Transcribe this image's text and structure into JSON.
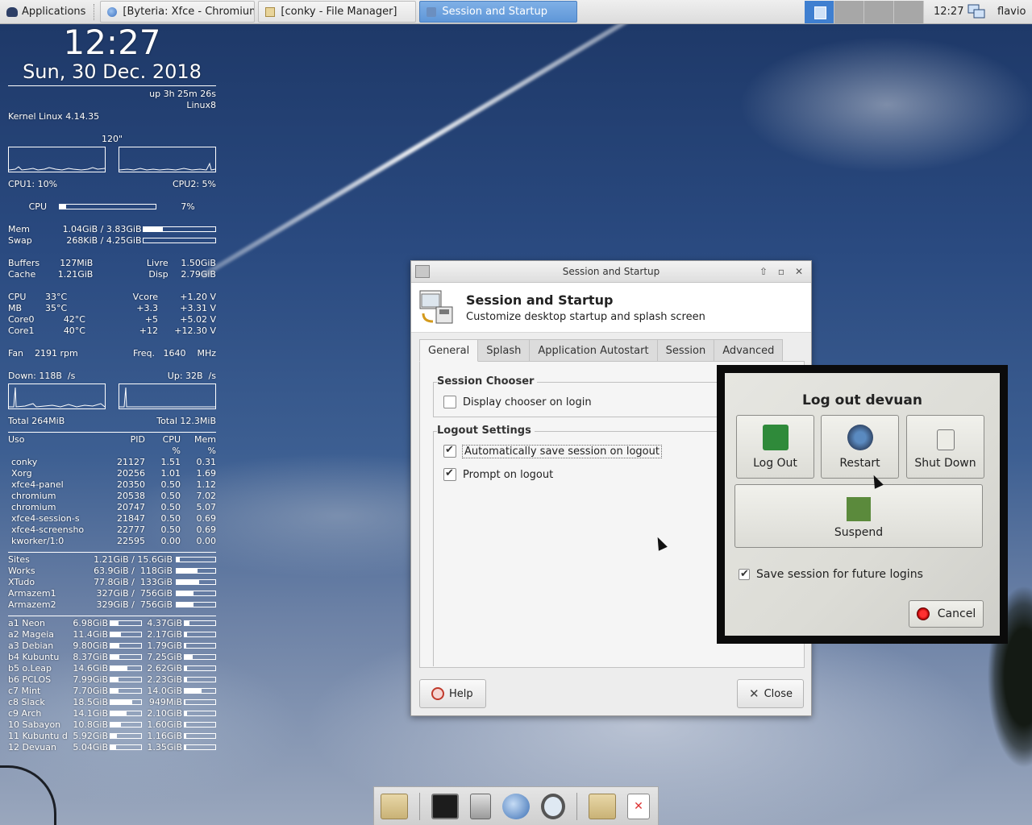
{
  "top_panel": {
    "applications_label": "Applications",
    "tasks": [
      {
        "label": "[Byteria: Xfce - Chromium]",
        "icon": "chromium-icon"
      },
      {
        "label": "[conky - File Manager]",
        "icon": "folder-icon"
      },
      {
        "label": "Session and Startup",
        "icon": "settings-icon"
      }
    ],
    "workspaces": 4,
    "active_workspace": 1,
    "clock": "12:27",
    "user": "flavio",
    "colors": {
      "active_task": "#5f97d8",
      "active_workspace": "#3f7fd0"
    }
  },
  "conky": {
    "time": "12:27",
    "date": "Sun, 30 Dec. 2018",
    "uptime": "up 3h 25m 26s",
    "host": "Linux8",
    "kernel": "Kernel Linux 4.14.35",
    "interval": "120\"",
    "cpu1": "CPU1: 10%",
    "cpu2": "CPU2: 5%",
    "cpu_label": "CPU",
    "cpu_pct_text": "7%",
    "cpu_pct": 0.07,
    "mem_label": "Mem",
    "mem_value": "1.04GiB / 3.83GiB",
    "mem_pct": 0.27,
    "swap_label": "Swap",
    "swap_value": "268KiB / 4.25GiB",
    "swap_pct": 0.0,
    "buffers_label": "Buffers",
    "buffers_value": "127MiB",
    "livre_label": "Livre",
    "livre_value": "1.50GiB",
    "cache_label": "Cache",
    "cache_value": "1.21GiB",
    "disp_label": "Disp",
    "disp_value": "2.79GiB",
    "sensors": [
      {
        "a": "CPU",
        "b": "33°C",
        "c": "Vcore",
        "d": "+1.20 V"
      },
      {
        "a": "MB",
        "b": "35°C",
        "c": "+3.3",
        "d": "+3.31 V"
      },
      {
        "a": "Core0",
        "b": "42°C",
        "c": "+5",
        "d": "+5.02 V"
      },
      {
        "a": "Core1",
        "b": "40°C",
        "c": "+12",
        "d": "+12.30 V"
      }
    ],
    "fan": "Fan    2191 rpm",
    "freq": "Freq.   1640    MHz",
    "down": "Down: 118B  /s",
    "up": "Up: 32B  /s",
    "total_down": "Total 264MiB",
    "total_up": "Total 12.3MiB",
    "proc_headers": {
      "name": "Uso",
      "pid": "PID",
      "cpu": "CPU",
      "mem": "Mem",
      "cpu_unit": "%",
      "mem_unit": "%"
    },
    "processes": [
      {
        "name": "conky",
        "pid": "21127",
        "cpu": "1.51",
        "mem": "0.31"
      },
      {
        "name": "Xorg",
        "pid": "20256",
        "cpu": "1.01",
        "mem": "1.69"
      },
      {
        "name": "xfce4-panel",
        "pid": "20350",
        "cpu": "0.50",
        "mem": "1.12"
      },
      {
        "name": "chromium",
        "pid": "20538",
        "cpu": "0.50",
        "mem": "7.02"
      },
      {
        "name": "chromium",
        "pid": "20747",
        "cpu": "0.50",
        "mem": "5.07"
      },
      {
        "name": "xfce4-session-s",
        "pid": "21847",
        "cpu": "0.50",
        "mem": "0.69"
      },
      {
        "name": "xfce4-screensho",
        "pid": "22777",
        "cpu": "0.50",
        "mem": "0.69"
      },
      {
        "name": "kworker/1:0",
        "pid": "22595",
        "cpu": "0.00",
        "mem": "0.00"
      }
    ],
    "disks": [
      {
        "name": "Sites",
        "usage": "1.21GiB / 15.6GiB",
        "pct": 0.08
      },
      {
        "name": "Works",
        "usage": "63.9GiB /  118GiB",
        "pct": 0.54
      },
      {
        "name": "XTudo",
        "usage": "77.8GiB /  133GiB",
        "pct": 0.58
      },
      {
        "name": "Armazem1",
        "usage": "327GiB /  756GiB",
        "pct": 0.43
      },
      {
        "name": "Armazem2",
        "usage": "329GiB /  756GiB",
        "pct": 0.44
      }
    ],
    "partitions": [
      {
        "name": "a1 Neon",
        "a": "6.98GiB",
        "ap": 0.25,
        "b": "4.37GiB",
        "bp": 0.15
      },
      {
        "name": "a2 Mageia",
        "a": "11.4GiB",
        "ap": 0.35,
        "b": "2.17GiB",
        "bp": 0.08
      },
      {
        "name": "a3 Debian",
        "a": "9.80GiB",
        "ap": 0.3,
        "b": "1.79GiB",
        "bp": 0.06
      },
      {
        "name": "b4 Kubuntu",
        "a": "8.37GiB",
        "ap": 0.28,
        "b": "7.25GiB",
        "bp": 0.25
      },
      {
        "name": "b5 o.Leap",
        "a": "14.6GiB",
        "ap": 0.55,
        "b": "2.62GiB",
        "bp": 0.09
      },
      {
        "name": "b6 PCLOS",
        "a": "7.99GiB",
        "ap": 0.27,
        "b": "2.23GiB",
        "bp": 0.08
      },
      {
        "name": "c7 Mint",
        "a": "7.70GiB",
        "ap": 0.26,
        "b": "14.0GiB",
        "bp": 0.55
      },
      {
        "name": "c8 Slack",
        "a": "18.5GiB",
        "ap": 0.72,
        "b": "949MiB",
        "bp": 0.03
      },
      {
        "name": "c9 Arch",
        "a": "14.1GiB",
        "ap": 0.52,
        "b": "2.10GiB",
        "bp": 0.07
      },
      {
        "name": "10 Sabayon",
        "a": "10.8GiB",
        "ap": 0.35,
        "b": "1.60GiB",
        "bp": 0.05
      },
      {
        "name": "11 Kubuntu d",
        "a": "5.92GiB",
        "ap": 0.2,
        "b": "1.16GiB",
        "bp": 0.04
      },
      {
        "name": "12 Devuan",
        "a": "5.04GiB",
        "ap": 0.18,
        "b": "1.35GiB",
        "bp": 0.05
      }
    ]
  },
  "session_dialog": {
    "window_title": "Session and Startup",
    "title": "Session and Startup",
    "subtitle": "Customize desktop startup and splash screen",
    "tabs": [
      "General",
      "Splash",
      "Application Autostart",
      "Session",
      "Advanced"
    ],
    "active_tab": "General",
    "session_chooser_title": "Session Chooser",
    "display_chooser_label": "Display chooser on login",
    "display_chooser_checked": false,
    "logout_settings_title": "Logout Settings",
    "auto_save_label": "Automatically save session on logout",
    "auto_save_checked": true,
    "prompt_logout_label": "Prompt on logout",
    "prompt_logout_checked": true,
    "help_label": "Help",
    "close_label": "Close"
  },
  "logout_dialog": {
    "title": "Log out devuan",
    "logout_label": "Log Out",
    "restart_label": "Restart",
    "shutdown_label": "Shut Down",
    "suspend_label": "Suspend",
    "save_session_label": "Save session for future logins",
    "save_session_checked": true,
    "cancel_label": "Cancel"
  },
  "dock": {
    "items": [
      "home-folder-icon",
      "terminal-icon",
      "file-cabinet-icon",
      "web-browser-icon",
      "search-icon",
      "folder-icon",
      "document-icon"
    ]
  }
}
